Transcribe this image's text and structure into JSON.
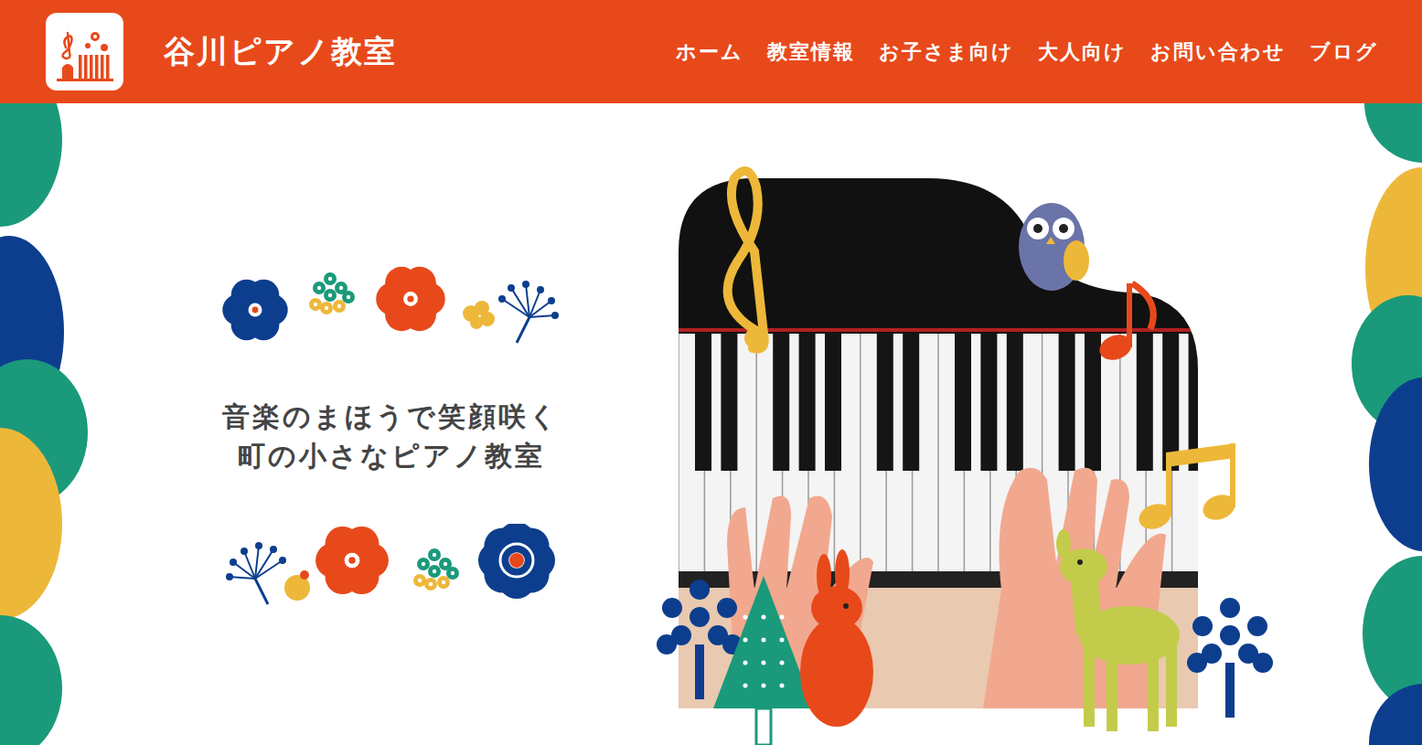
{
  "header": {
    "title": "谷川ピアノ教室"
  },
  "nav": [
    {
      "label": "ホーム"
    },
    {
      "label": "教室情報"
    },
    {
      "label": "お子さま向け"
    },
    {
      "label": "大人向け"
    },
    {
      "label": "お問い合わせ"
    },
    {
      "label": "ブログ"
    }
  ],
  "hero": {
    "tagline": [
      "音楽のまほうで笑顔咲く",
      "町の小さなピアノ教室"
    ]
  }
}
